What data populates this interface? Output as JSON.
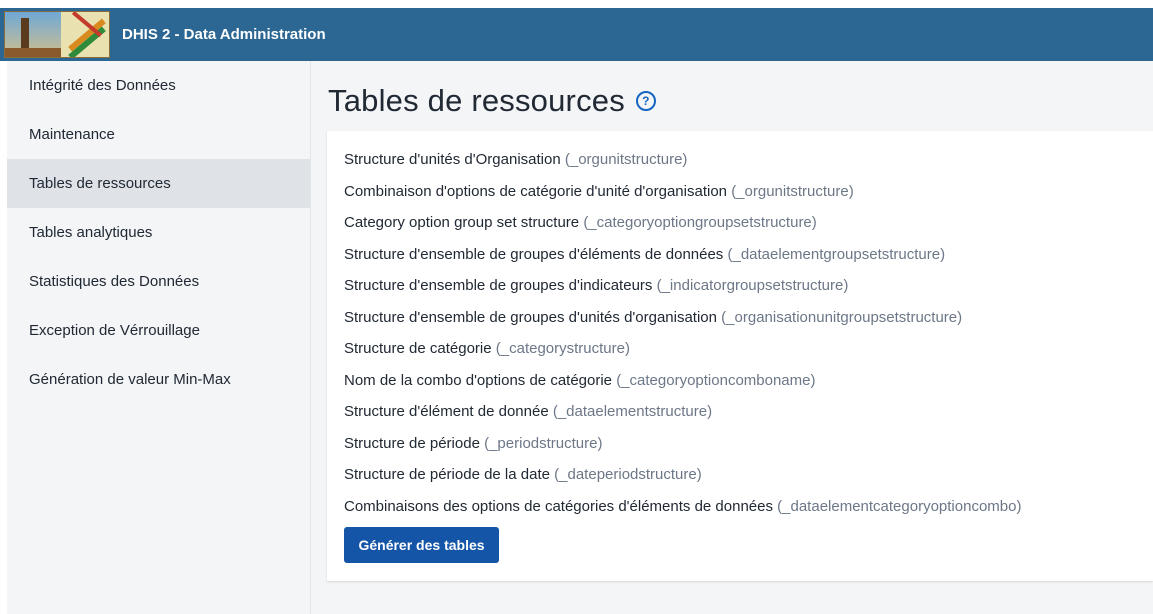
{
  "header": {
    "app_title": "DHIS 2 - Data Administration"
  },
  "sidebar": {
    "items": [
      {
        "label": "Intégrité des Données"
      },
      {
        "label": "Maintenance"
      },
      {
        "label": "Tables de ressources"
      },
      {
        "label": "Tables analytiques"
      },
      {
        "label": "Statistiques des Données"
      },
      {
        "label": "Exception de Vérrouillage"
      },
      {
        "label": "Génération de valeur Min-Max"
      }
    ],
    "active_index": 2
  },
  "main": {
    "title": "Tables de ressources",
    "help_icon": "?",
    "tables": [
      {
        "name": "Structure d'unités d'Organisation",
        "code": "(_orgunitstructure)"
      },
      {
        "name": "Combinaison d'options de catégorie d'unité d'organisation",
        "code": "(_orgunitstructure)"
      },
      {
        "name": "Category option group set structure",
        "code": "(_categoryoptiongroupsetstructure)"
      },
      {
        "name": "Structure d'ensemble de groupes d'éléments de données",
        "code": "(_dataelementgroupsetstructure)"
      },
      {
        "name": "Structure d'ensemble de groupes d'indicateurs",
        "code": "(_indicatorgroupsetstructure)"
      },
      {
        "name": "Structure d'ensemble de groupes d'unités d'organisation",
        "code": "(_organisationunitgroupsetstructure)"
      },
      {
        "name": "Structure de catégorie",
        "code": "(_categorystructure)"
      },
      {
        "name": "Nom de la combo d'options de catégorie",
        "code": "(_categoryoptioncomboname)"
      },
      {
        "name": "Structure d'élément de donnée",
        "code": "(_dataelementstructure)"
      },
      {
        "name": "Structure de période",
        "code": "(_periodstructure)"
      },
      {
        "name": "Structure de période de la date",
        "code": "(_dateperiodstructure)"
      },
      {
        "name": "Combinaisons des options de catégories d'éléments de données",
        "code": "(_dataelementcategoryoptioncombo)"
      }
    ],
    "generate_button": "Générer des tables"
  }
}
